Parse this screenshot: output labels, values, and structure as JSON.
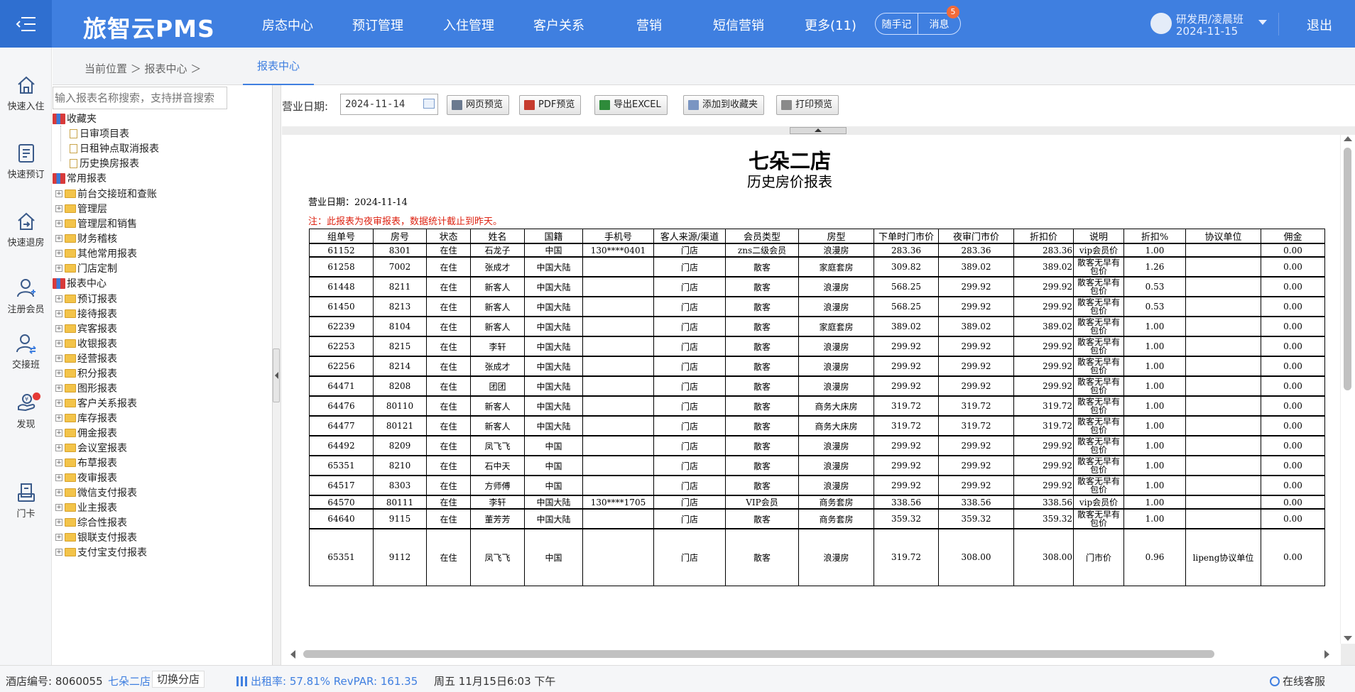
{
  "header": {
    "logo": "旅智云PMS",
    "nav": [
      "房态中心",
      "预订管理",
      "入住管理",
      "客户关系",
      "营销",
      "短信营销",
      "更多(11)"
    ],
    "notes_label": "随手记",
    "messages_label": "消息",
    "messages_badge": "5",
    "user_name": "研发用/凌晨班",
    "user_date": "2024-11-15",
    "logout": "退出"
  },
  "sidebar": {
    "items": [
      {
        "label": "快速入住",
        "icon": "home-icon"
      },
      {
        "label": "快速预订",
        "icon": "clipboard-icon"
      },
      {
        "label": "快速退房",
        "icon": "checkout-icon"
      },
      {
        "label": "注册会员",
        "icon": "add-user-icon"
      },
      {
        "label": "交接班",
        "icon": "shift-user-icon"
      },
      {
        "label": "发现",
        "icon": "discover-icon"
      },
      {
        "label": "门卡",
        "icon": "card-icon"
      }
    ]
  },
  "breadcrumb": {
    "path": "当前位置 ＞ 报表中心 ＞",
    "tab": "报表中心"
  },
  "tree": {
    "search_placeholder": "输入报表名称搜索，支持拼音搜索",
    "favorites_label": "收藏夹",
    "favorites": [
      "日审项目表",
      "日租钟点取消报表",
      "历史换房报表"
    ],
    "common_label": "常用报表",
    "common": [
      "前台交接班和查账",
      "管理层",
      "管理层和销售",
      "财务稽核",
      "其他常用报表",
      "门店定制"
    ],
    "center_label": "报表中心",
    "center": [
      "预订报表",
      "接待报表",
      "宾客报表",
      "收银报表",
      "经营报表",
      "积分报表",
      "图形报表",
      "客户关系报表",
      "库存报表",
      "佣金报表",
      "会议室报表",
      "布草报表",
      "夜审报表",
      "微信支付报表",
      "业主报表",
      "综合性报表",
      "银联支付报表",
      "支付宝支付报表"
    ]
  },
  "toolbar": {
    "date_label": "营业日期:",
    "date_value": "2024-11-14",
    "buttons": [
      "网页预览",
      "PDF预览",
      "导出EXCEL",
      "添加到收藏夹",
      "打印预览"
    ]
  },
  "report": {
    "hotel": "七朵二店",
    "title": "历史房价报表",
    "date_line": "营业日期：2024-11-14",
    "note": "注：此报表为夜审报表，数据统计截止到昨天。",
    "columns": [
      "组单号",
      "房号",
      "状态",
      "姓名",
      "国籍",
      "手机号",
      "客人来源/渠道",
      "会员类型",
      "房型",
      "下单时门市价",
      "夜审门市价",
      "折扣价",
      "说明",
      "折扣%",
      "协议单位",
      "佣金"
    ],
    "rows": [
      [
        "61152",
        "8301",
        "在住",
        "石龙子",
        "中国",
        "130****0401",
        "门店",
        "zns二级会员",
        "浪漫房",
        "283.36",
        "283.36",
        "283.36",
        "vip会员价",
        "1.00",
        "",
        "0.00"
      ],
      [
        "61258",
        "7002",
        "在住",
        "张成才",
        "中国大陆",
        "",
        "门店",
        "散客",
        "家庭套房",
        "309.82",
        "389.02",
        "389.02",
        "散客无早有包价",
        "1.26",
        "",
        "0.00"
      ],
      [
        "61448",
        "8211",
        "在住",
        "新客人",
        "中国大陆",
        "",
        "门店",
        "散客",
        "浪漫房",
        "568.25",
        "299.92",
        "299.92",
        "散客无早有包价",
        "0.53",
        "",
        "0.00"
      ],
      [
        "61450",
        "8213",
        "在住",
        "新客人",
        "中国大陆",
        "",
        "门店",
        "散客",
        "浪漫房",
        "568.25",
        "299.92",
        "299.92",
        "散客无早有包价",
        "0.53",
        "",
        "0.00"
      ],
      [
        "62239",
        "8104",
        "在住",
        "新客人",
        "中国大陆",
        "",
        "门店",
        "散客",
        "家庭套房",
        "389.02",
        "389.02",
        "389.02",
        "散客无早有包价",
        "1.00",
        "",
        "0.00"
      ],
      [
        "62253",
        "8215",
        "在住",
        "李轩",
        "中国大陆",
        "",
        "门店",
        "散客",
        "浪漫房",
        "299.92",
        "299.92",
        "299.92",
        "散客无早有包价",
        "1.00",
        "",
        "0.00"
      ],
      [
        "62256",
        "8214",
        "在住",
        "张成才",
        "中国大陆",
        "",
        "门店",
        "散客",
        "浪漫房",
        "299.92",
        "299.92",
        "299.92",
        "散客无早有包价",
        "1.00",
        "",
        "0.00"
      ],
      [
        "64471",
        "8208",
        "在住",
        "团团",
        "中国大陆",
        "",
        "门店",
        "散客",
        "浪漫房",
        "299.92",
        "299.92",
        "299.92",
        "散客无早有包价",
        "1.00",
        "",
        "0.00"
      ],
      [
        "64476",
        "80110",
        "在住",
        "新客人",
        "中国大陆",
        "",
        "门店",
        "散客",
        "商务大床房",
        "319.72",
        "319.72",
        "319.72",
        "散客无早有包价",
        "1.00",
        "",
        "0.00"
      ],
      [
        "64477",
        "80121",
        "在住",
        "新客人",
        "中国大陆",
        "",
        "门店",
        "散客",
        "商务大床房",
        "319.72",
        "319.72",
        "319.72",
        "散客无早有包价",
        "1.00",
        "",
        "0.00"
      ],
      [
        "64492",
        "8209",
        "在住",
        "凤飞飞",
        "中国",
        "",
        "门店",
        "散客",
        "浪漫房",
        "299.92",
        "299.92",
        "299.92",
        "散客无早有包价",
        "1.00",
        "",
        "0.00"
      ],
      [
        "65351",
        "8210",
        "在住",
        "石中天",
        "中国",
        "",
        "门店",
        "散客",
        "浪漫房",
        "299.92",
        "299.92",
        "299.92",
        "散客无早有包价",
        "1.00",
        "",
        "0.00"
      ],
      [
        "64517",
        "8303",
        "在住",
        "方师傅",
        "中国",
        "",
        "门店",
        "散客",
        "浪漫房",
        "299.92",
        "299.92",
        "299.92",
        "散客无早有包价",
        "1.00",
        "",
        "0.00"
      ],
      [
        "64570",
        "80111",
        "在住",
        "李轩",
        "中国大陆",
        "130****1705",
        "门店",
        "VIP会员",
        "商务套房",
        "338.56",
        "338.56",
        "338.56",
        "vip会员价",
        "1.00",
        "",
        "0.00"
      ],
      [
        "64640",
        "9115",
        "在住",
        "董芳芳",
        "中国大陆",
        "",
        "门店",
        "散客",
        "商务套房",
        "359.32",
        "359.32",
        "359.32",
        "散客无早有包价",
        "1.00",
        "",
        "0.00"
      ],
      [
        "65351",
        "9112",
        "在住",
        "凤飞飞",
        "中国",
        "",
        "门店",
        "散客",
        "浪漫房",
        "319.72",
        "308.00",
        "308.00",
        "门市价",
        "0.96",
        "lipeng协议单位",
        "0.00"
      ]
    ]
  },
  "status": {
    "hotel_code": "酒店编号:  8060055",
    "hotel_name": "七朵二店",
    "switch": "切换分店",
    "occupancy": "出租率:  57.81%  RevPAR:  161.35",
    "datetime": "周五 11月15日6:03 下午",
    "service": "在线客服"
  },
  "colors": {
    "primary": "#3f7fe0",
    "note_red": "#dd2211"
  }
}
